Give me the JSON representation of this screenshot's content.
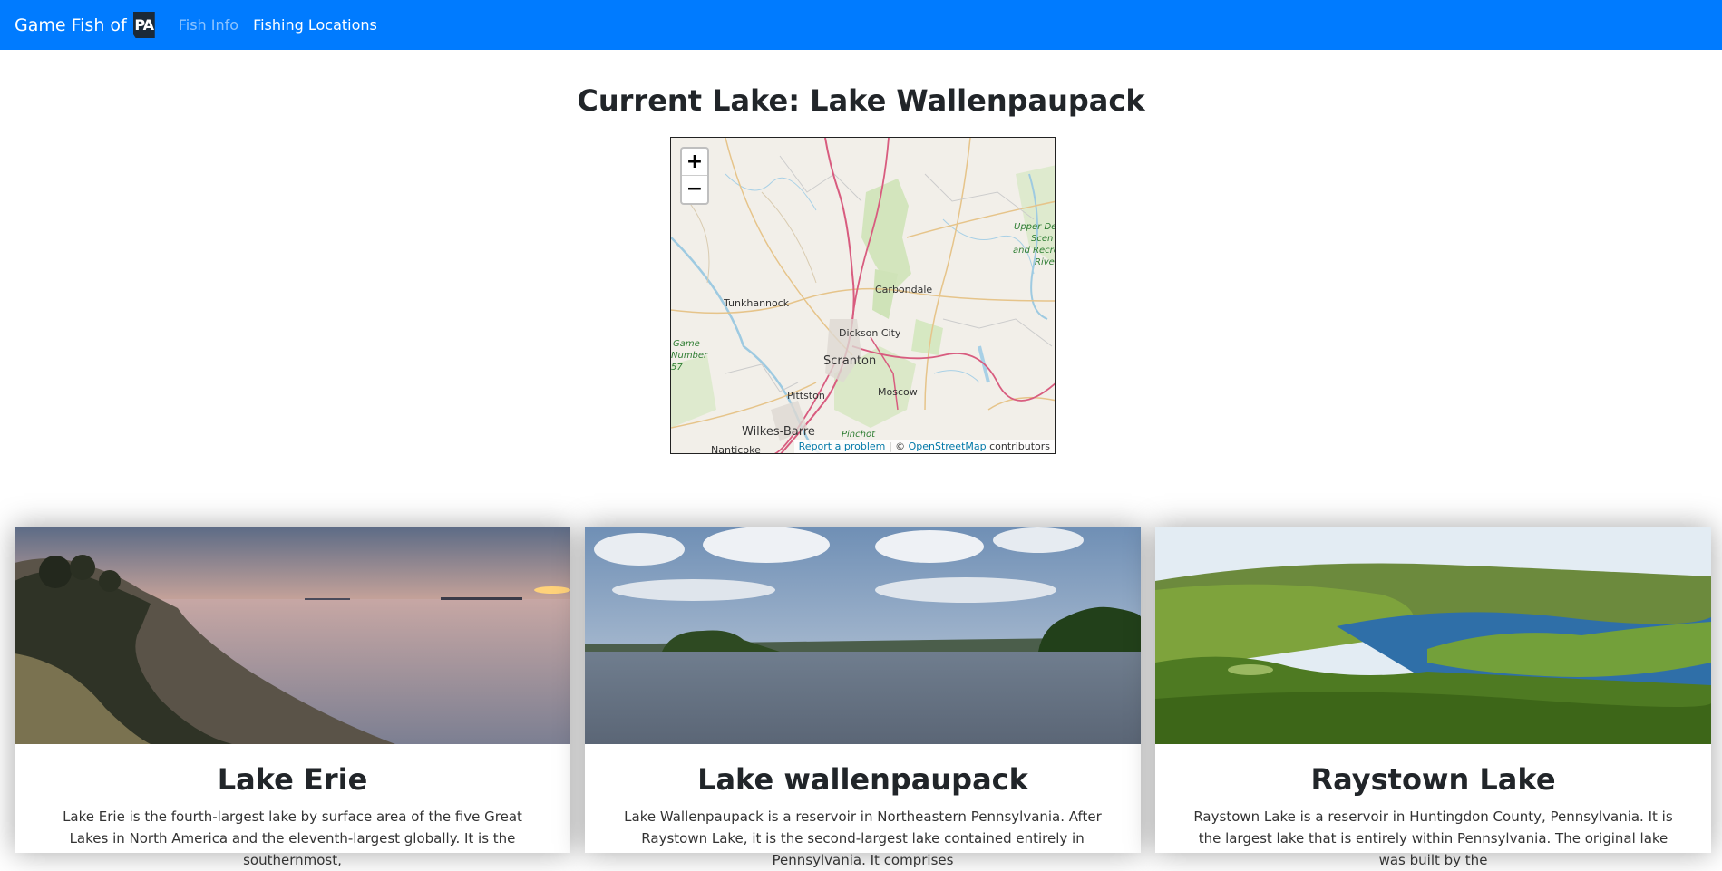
{
  "navbar": {
    "brand_text": "Game Fish of",
    "brand_logo": "PA",
    "links": [
      {
        "label": "Fish Info"
      },
      {
        "label": "Fishing Locations"
      }
    ]
  },
  "main": {
    "title": "Current Lake: Lake Wallenpaupack"
  },
  "map": {
    "zoom_in": "+",
    "zoom_out": "−",
    "labels": {
      "tunkhannock": "Tunkhannock",
      "carbondale": "Carbondale",
      "dickson_city": "Dickson City",
      "scranton": "Scranton",
      "pittston": "Pittston",
      "moscow": "Moscow",
      "wilkes_barre": "Wilkes-Barre",
      "nanticoke": "Nanticoke",
      "pinchot": "Pinchot",
      "game_1": "Game",
      "game_2": "Number",
      "game_3": "57",
      "upper_1": "Upper De",
      "upper_2": "Scen",
      "upper_3": "and Recre",
      "upper_4": "Rive"
    },
    "attribution": {
      "report": "Report a problem",
      "sep": " | © ",
      "osm": "OpenStreetMap",
      "suffix": " contributors"
    }
  },
  "cards": [
    {
      "title": "Lake Erie",
      "text": "Lake Erie is the fourth-largest lake by surface area of the five Great Lakes in North America and the eleventh-largest globally. It is the southernmost,"
    },
    {
      "title": "Lake wallenpaupack",
      "text": "Lake Wallenpaupack is a reservoir in Northeastern Pennsylvania. After Raystown Lake, it is the second-largest lake contained entirely in Pennsylvania. It comprises"
    },
    {
      "title": "Raystown Lake",
      "text": "Raystown Lake is a reservoir in Huntingdon County, Pennsylvania. It is the largest lake that is entirely within Pennsylvania. The original lake was built by the"
    }
  ],
  "colors": {
    "navbar": "#007bff",
    "link_active": "#ffffff",
    "link_muted": "rgba(255,255,255,0.55)"
  }
}
